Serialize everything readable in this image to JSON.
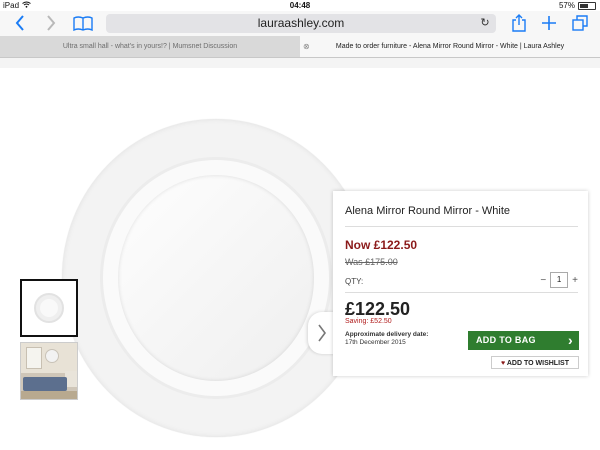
{
  "status_bar": {
    "device": "iPad",
    "time": "04:48",
    "battery": "57%",
    "battery_level": 0.57
  },
  "toolbar": {
    "url": "lauraashley.com"
  },
  "tabs": [
    {
      "label": "Ultra small hall - what's in yours!? | Mumsnet Discussion",
      "active": false
    },
    {
      "label": "Made to order furniture - Alena Mirror Round Mirror - White | Laura Ashley",
      "active": true
    }
  ],
  "product": {
    "title": "Alena Mirror Round Mirror - White",
    "now_price": "Now £122.50",
    "was_price": "Was £175.00",
    "qty_label": "QTY:",
    "qty_minus": "−",
    "qty_value": "1",
    "qty_plus": "+",
    "price": "£122.50",
    "saving": "Saving: £52.50",
    "delivery_label": "Approximate delivery date:",
    "delivery_date": "17th December 2015",
    "add_to_bag": "ADD TO BAG",
    "add_to_wishlist": "ADD TO WISHLIST"
  },
  "icons": {
    "back": "chevron-left-icon",
    "forward": "chevron-right-icon",
    "bookmarks": "book-icon",
    "reload": "reload-icon",
    "share": "share-icon",
    "new_tab": "plus-icon",
    "tabs": "tabs-icon",
    "next_image": "chevron-right-icon",
    "wishlist": "heart-icon"
  },
  "colors": {
    "accent": "#1a7cf5",
    "price_red": "#8b1a1a",
    "button_green": "#2f7d2f"
  }
}
